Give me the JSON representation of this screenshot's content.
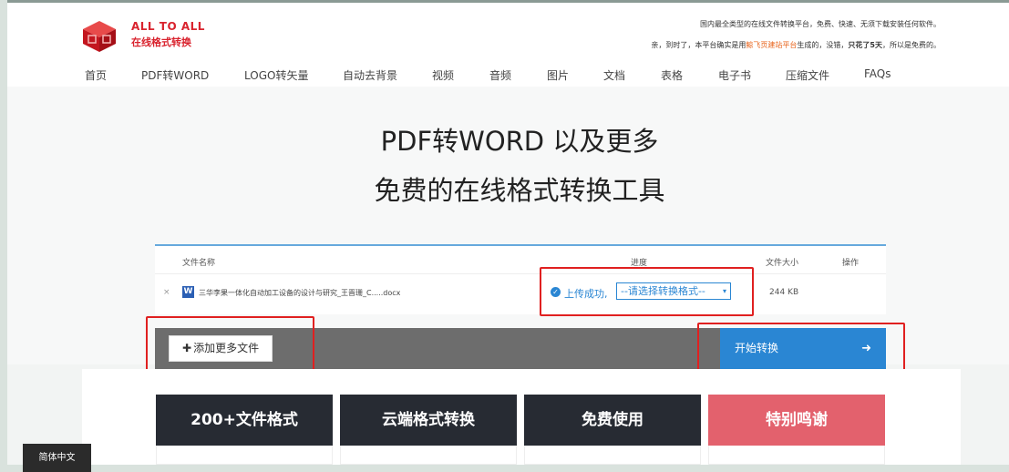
{
  "logo": {
    "en": "ALL TO ALL",
    "cn": "在线格式转换"
  },
  "notices": {
    "line1": "国内最全类型的在线文件转换平台，免费、快速、无须下载安装任何软件。",
    "line2_pre": "亲，到时了，本平台确实是用",
    "line2_highlight": "鲸飞页建站平台",
    "line2_mid": "生成的，没错，",
    "line2_bold": "只花了5天",
    "line2_post": "，所以是免费的。"
  },
  "nav": [
    "首页",
    "PDF转WORD",
    "LOGO转矢量",
    "自动去背景",
    "视频",
    "音频",
    "图片",
    "文档",
    "表格",
    "电子书",
    "压缩文件",
    "FAQs"
  ],
  "hero": {
    "line1": "PDF转WORD 以及更多",
    "line2": "免费的在线格式转换工具"
  },
  "table": {
    "headers": {
      "name": "文件名称",
      "progress": "进度",
      "size": "文件大小",
      "action": "操作"
    },
    "row": {
      "remove": "×",
      "file_icon": "W",
      "file_name": "三华李果一体化自动加工设备的设计与研究_王晋珊_C.....docx",
      "status": "上传成功,",
      "format_select": "--请选择转换格式--",
      "size": "244 KB"
    }
  },
  "actions": {
    "add_files": "添加更多文件",
    "start": "开始转换",
    "start_arrow": "➜",
    "plus": "✚"
  },
  "features": [
    {
      "label": "200+文件格式",
      "color": "#272b33"
    },
    {
      "label": "云端格式转换",
      "color": "#272b33"
    },
    {
      "label": "免费使用",
      "color": "#272b33"
    },
    {
      "label": "特别鸣谢",
      "color": "#e3616d"
    }
  ],
  "language": "简体中文",
  "colors": {
    "brand_red": "#d9232e",
    "accent_blue": "#2a86d3",
    "highlight_box": "#e02020"
  }
}
